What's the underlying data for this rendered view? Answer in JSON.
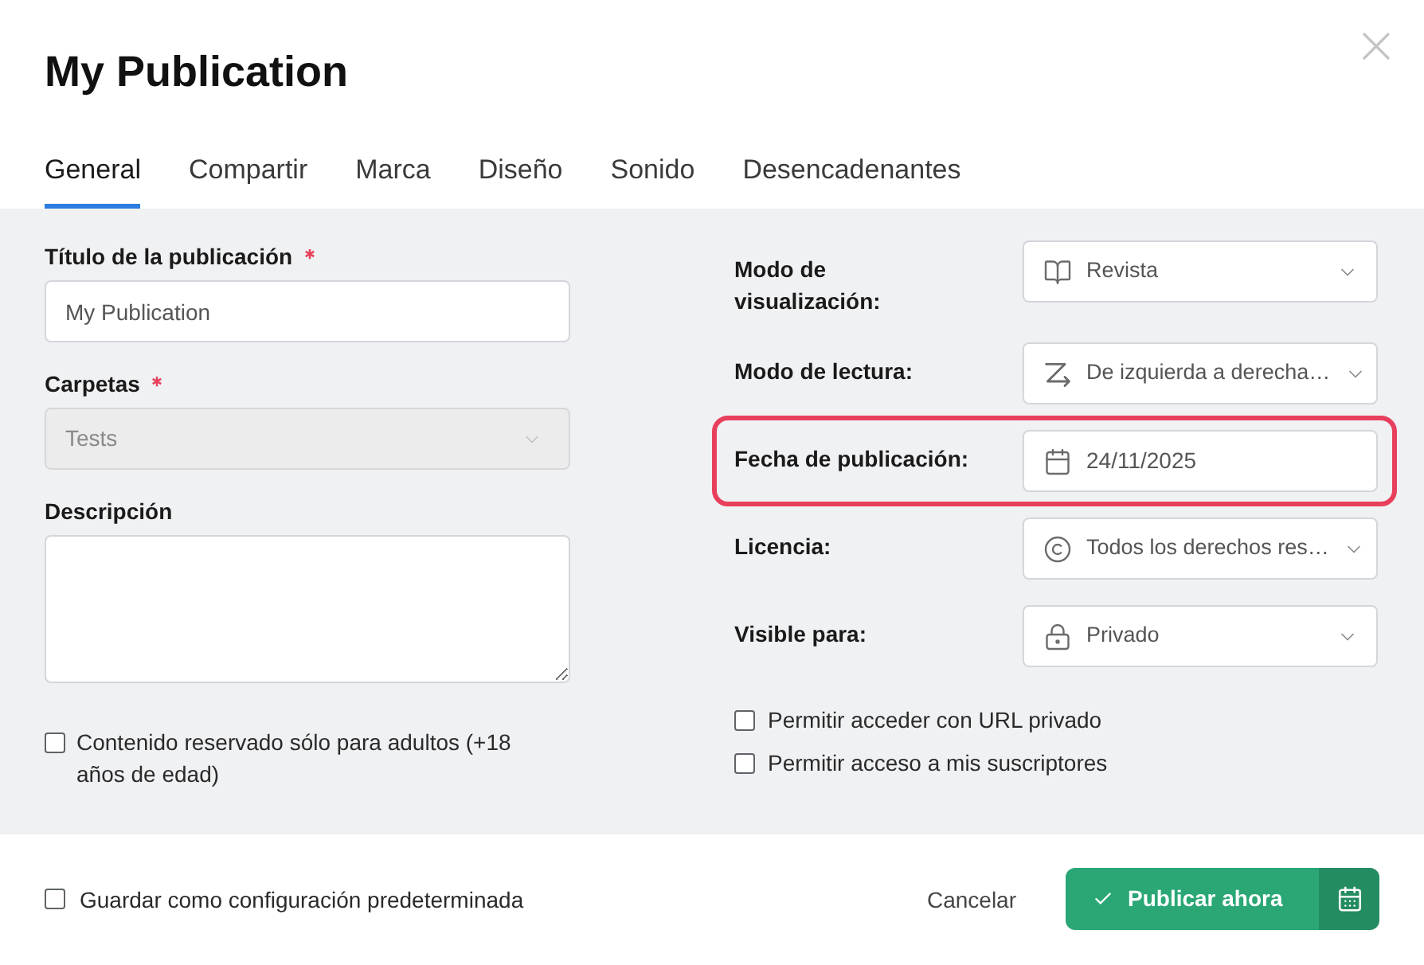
{
  "dialog": {
    "title": "My Publication"
  },
  "tabs": [
    {
      "label": "General",
      "selected": true
    },
    {
      "label": "Compartir",
      "selected": false
    },
    {
      "label": "Marca",
      "selected": false
    },
    {
      "label": "Diseño",
      "selected": false
    },
    {
      "label": "Sonido",
      "selected": false
    },
    {
      "label": "Desencadenantes",
      "selected": false
    }
  ],
  "left_fields": [
    {
      "kind": "text",
      "label": "Título de la publicación",
      "required": true,
      "disabled": false,
      "value": "My Publication"
    },
    {
      "kind": "select",
      "label": "Carpetas",
      "required": true,
      "disabled": true,
      "value": "Tests"
    },
    {
      "kind": "textarea",
      "label": "Descripción",
      "required": false,
      "disabled": false
    }
  ],
  "adult_content": {
    "label": "Contenido reservado sólo para adultos (+18 años de edad)",
    "checked": false
  },
  "settings": [
    {
      "kind": "select",
      "label": "Modo de visualización:",
      "value": "Revista",
      "highlighted": false
    },
    {
      "kind": "select",
      "label": "Modo de lectura:",
      "value": "De izquierda a derecha…",
      "highlighted": false
    },
    {
      "kind": "date",
      "label": "Fecha de publicación:",
      "value": "24/11/2025",
      "highlighted": true
    },
    {
      "kind": "select",
      "label": "Licencia:",
      "value": "Todos los derechos res…",
      "highlighted": false
    },
    {
      "kind": "select",
      "label": "Visible para:",
      "value": "Privado",
      "highlighted": false
    }
  ],
  "access_options": [
    {
      "label": "Permitir acceder con URL privado",
      "checked": false
    },
    {
      "label": "Permitir acceso a mis suscriptores",
      "checked": false
    }
  ],
  "footer": {
    "save_default": {
      "label": "Guardar como configuración predeterminada",
      "checked": false
    },
    "cancel": "Cancelar",
    "publish": "Publicar ahora"
  }
}
